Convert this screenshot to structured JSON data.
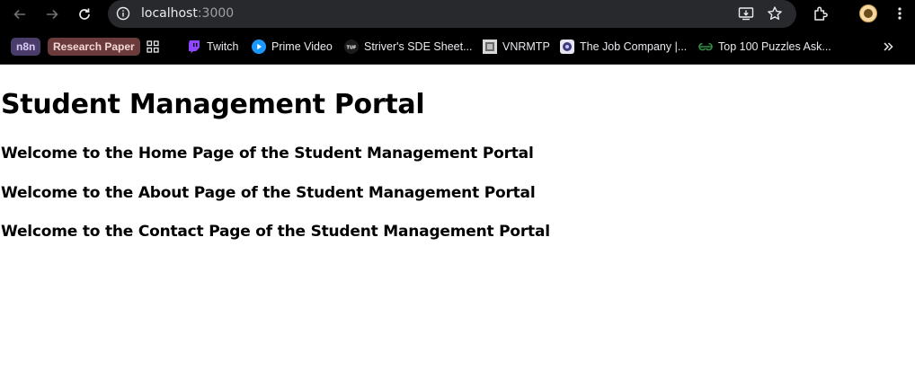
{
  "browser": {
    "url_host": "localhost",
    "url_port": ":3000"
  },
  "bookmarks": [
    {
      "label": "n8n",
      "icon": "n8n-chip",
      "bg": "#4b3d6b",
      "fg": "#d7ccf5"
    },
    {
      "label": "Research Paper",
      "icon": "research-chip",
      "bg": "#6b3b3b",
      "fg": "#f3d6d6"
    },
    {
      "label": "",
      "icon": "apps-grid-icon"
    },
    {
      "label": "Twitch",
      "icon": "twitch-icon"
    },
    {
      "label": "Prime Video",
      "icon": "prime-video-icon"
    },
    {
      "label": "Striver's SDE Sheet...",
      "icon": "tuf-icon"
    },
    {
      "label": "VNRMTP",
      "icon": "vnrmtp-icon"
    },
    {
      "label": "The Job Company |...",
      "icon": "job-company-icon"
    },
    {
      "label": "Top 100 Puzzles Ask...",
      "icon": "gfg-icon"
    }
  ],
  "page": {
    "title": "Student Management Portal",
    "sections": [
      "Welcome to the Home Page of the Student Management Portal",
      "Welcome to the About Page of the Student Management Portal",
      "Welcome to the Contact Page of the Student Management Portal"
    ]
  },
  "colors": {
    "toolbar_bg": "#000000",
    "omnibox_bg": "#28292c",
    "text_light": "#e8eaed",
    "port_gray": "#9aa0a6"
  }
}
